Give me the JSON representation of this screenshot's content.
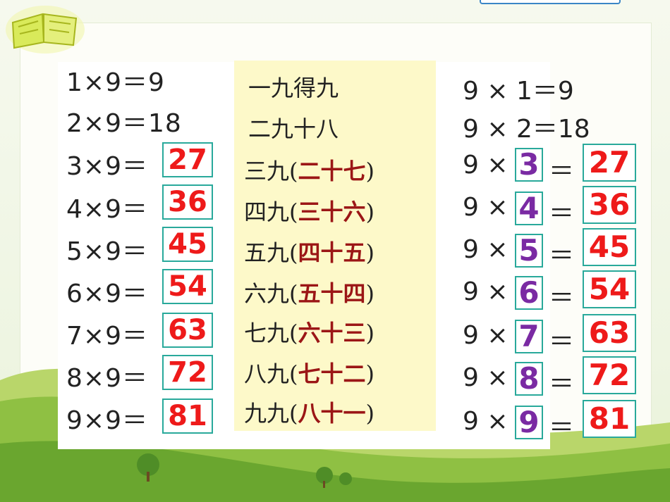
{
  "left_table": {
    "rows": [
      {
        "eq": "1×9＝9",
        "answer": ""
      },
      {
        "eq": "2×9＝18",
        "answer": ""
      },
      {
        "eq": "3×9＝",
        "answer": "27"
      },
      {
        "eq": "4×9＝",
        "answer": "36"
      },
      {
        "eq": "5×9＝",
        "answer": "45"
      },
      {
        "eq": "6×9＝",
        "answer": "54"
      },
      {
        "eq": "7×9＝",
        "answer": "63"
      },
      {
        "eq": "8×9＝",
        "answer": "72"
      },
      {
        "eq": "9×9＝",
        "answer": "81"
      }
    ]
  },
  "verses": {
    "rows": [
      {
        "head": "一九得九",
        "open": "",
        "ans": "",
        "close": ""
      },
      {
        "head": "二九十八",
        "open": "",
        "ans": "",
        "close": ""
      },
      {
        "head": "三九",
        "open": "(",
        "ans": "二十七",
        "close": ")"
      },
      {
        "head": "四九",
        "open": "(",
        "ans": "三十六",
        "close": ")"
      },
      {
        "head": "五九",
        "open": "(",
        "ans": "四十五",
        "close": ")"
      },
      {
        "head": "六九",
        "open": "(",
        "ans": "五十四",
        "close": ")"
      },
      {
        "head": "七九",
        "open": "(",
        "ans": "六十三",
        "close": ")"
      },
      {
        "head": "八九",
        "open": "(",
        "ans": "七十二",
        "close": ")"
      },
      {
        "head": "九九",
        "open": "(",
        "ans": "八十一",
        "close": ")"
      }
    ]
  },
  "right_table": {
    "rows": [
      {
        "lead": "9 × 1＝9",
        "factor": "",
        "eq_sign": "",
        "answer": ""
      },
      {
        "lead": "9 × 2＝18",
        "factor": "",
        "eq_sign": "",
        "answer": ""
      },
      {
        "lead": "9 ×",
        "factor": "3",
        "eq_sign": "＝",
        "answer": "27"
      },
      {
        "lead": "9 ×",
        "factor": "4",
        "eq_sign": "＝",
        "answer": "36"
      },
      {
        "lead": "9 ×",
        "factor": "5",
        "eq_sign": "＝",
        "answer": "45"
      },
      {
        "lead": "9 ×",
        "factor": "6",
        "eq_sign": "＝",
        "answer": "54"
      },
      {
        "lead": "9 ×",
        "factor": "7",
        "eq_sign": "＝",
        "answer": "63"
      },
      {
        "lead": "9 ×",
        "factor": "8",
        "eq_sign": "＝",
        "answer": "72"
      },
      {
        "lead": "9 ×",
        "factor": "9",
        "eq_sign": "＝",
        "answer": "81"
      }
    ]
  },
  "colors": {
    "answer_red": "#ee1a1a",
    "verse_answer": "#9b1616",
    "factor_purple": "#7a2aa3",
    "box_border": "#29a99b",
    "panel_yellow": "#fdf9c9"
  },
  "icons": {
    "decor": "book-icon"
  }
}
